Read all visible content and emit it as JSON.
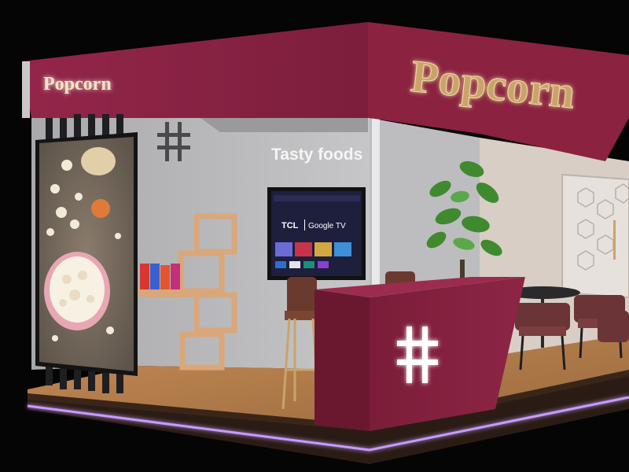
{
  "booth": {
    "left_sign": "Popcorn",
    "main_sign": "Popcorn",
    "tagline": "Tasty foods"
  },
  "tv": {
    "brand": "TCL",
    "platform": "Google TV"
  },
  "colors": {
    "fascia": "#8a2240",
    "fascia_dark": "#6a1830",
    "wall_gray": "#b9b9bb",
    "wall_beige": "#d9cfc7",
    "floor_wood": "#b07a4a",
    "sign_gold": "#c9a46a",
    "led_purple": "#b98cff"
  },
  "icons": [
    "hash-logo-icon",
    "hash-counter-icon"
  ]
}
